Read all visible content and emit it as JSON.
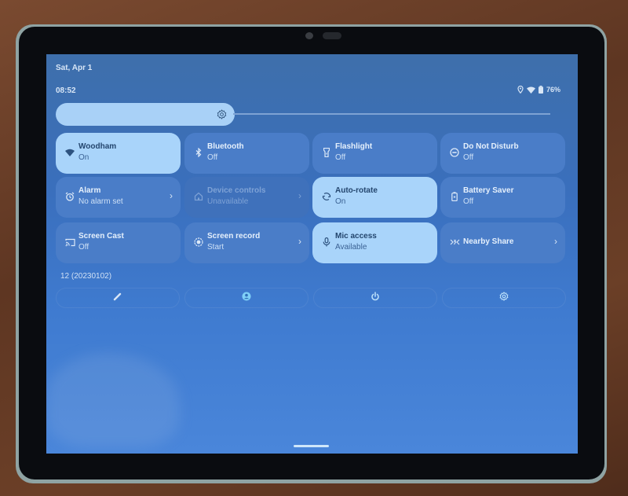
{
  "status_bar": {
    "date": "Sat, Apr 1",
    "time": "08:52",
    "battery": "76%",
    "icons": [
      "location-icon",
      "wifi-icon",
      "battery-icon"
    ]
  },
  "brightness": {
    "icon": "brightness-settings-icon"
  },
  "tiles": [
    {
      "label": "Woodham",
      "sub": "On",
      "state": "on",
      "icon": "wifi-icon"
    },
    {
      "label": "Bluetooth",
      "sub": "Off",
      "state": "off",
      "icon": "bluetooth-icon"
    },
    {
      "label": "Flashlight",
      "sub": "Off",
      "state": "off",
      "icon": "flashlight-icon"
    },
    {
      "label": "Do Not Disturb",
      "sub": "Off",
      "state": "off",
      "icon": "do-not-disturb-icon"
    },
    {
      "label": "Alarm",
      "sub": "No alarm set",
      "state": "off",
      "icon": "alarm-icon",
      "chevron": true
    },
    {
      "label": "Device controls",
      "sub": "Unavailable",
      "state": "unavailable",
      "icon": "home-icon",
      "chevron": true
    },
    {
      "label": "Auto-rotate",
      "sub": "On",
      "state": "on",
      "icon": "rotate-icon"
    },
    {
      "label": "Battery Saver",
      "sub": "Off",
      "state": "off",
      "icon": "battery-saver-icon"
    },
    {
      "label": "Screen Cast",
      "sub": "Off",
      "state": "off",
      "icon": "cast-icon"
    },
    {
      "label": "Screen record",
      "sub": "Start",
      "state": "off",
      "icon": "screen-record-icon",
      "chevron": true
    },
    {
      "label": "Mic access",
      "sub": "Available",
      "state": "on",
      "icon": "mic-icon"
    },
    {
      "label": "Nearby Share",
      "sub": "",
      "state": "off",
      "icon": "nearby-share-icon",
      "chevron": true
    }
  ],
  "chevron_glyph": "›",
  "build_number": "12 (20230102)",
  "footer": {
    "buttons": [
      {
        "name": "edit-button",
        "icon": "pencil-icon"
      },
      {
        "name": "user-button",
        "icon": "user-icon"
      },
      {
        "name": "power-button",
        "icon": "power-icon"
      },
      {
        "name": "settings-button",
        "icon": "gear-icon"
      }
    ]
  }
}
